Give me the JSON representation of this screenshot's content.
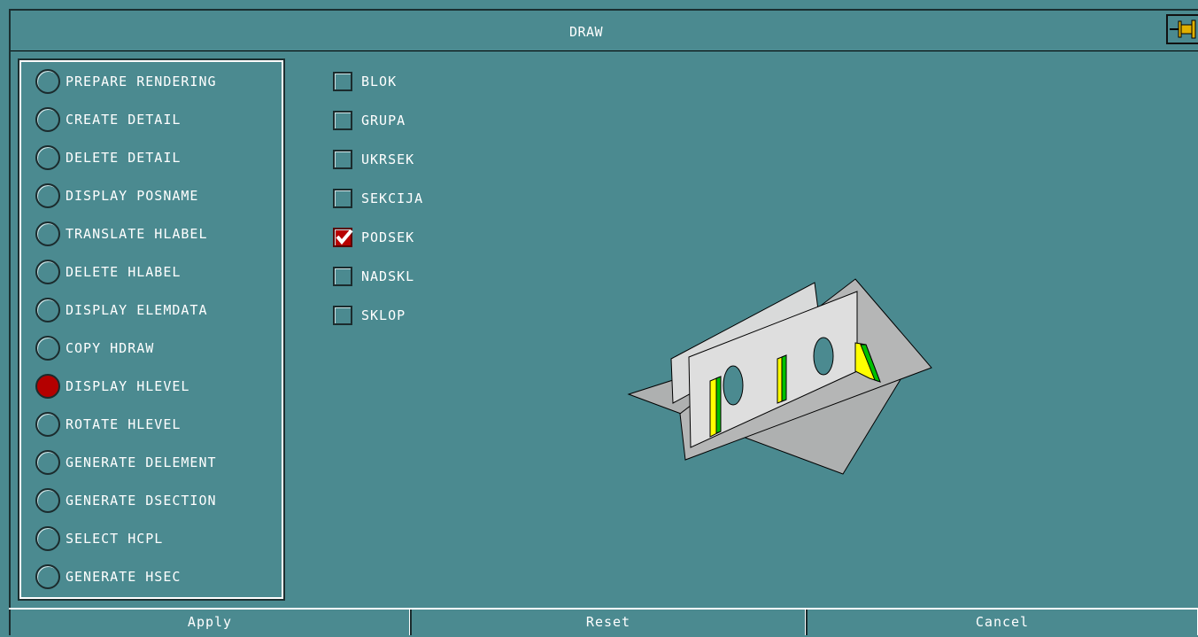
{
  "window": {
    "title": "DRAW"
  },
  "actions": [
    {
      "label": "PREPARE RENDERING",
      "checked": false
    },
    {
      "label": "CREATE DETAIL",
      "checked": false
    },
    {
      "label": "DELETE DETAIL",
      "checked": false
    },
    {
      "label": "DISPLAY POSNAME",
      "checked": false
    },
    {
      "label": "TRANSLATE HLABEL",
      "checked": false
    },
    {
      "label": "DELETE HLABEL",
      "checked": false
    },
    {
      "label": "DISPLAY ELEMDATA",
      "checked": false
    },
    {
      "label": "COPY HDRAW",
      "checked": false
    },
    {
      "label": "DISPLAY HLEVEL",
      "checked": true
    },
    {
      "label": "ROTATE HLEVEL",
      "checked": false
    },
    {
      "label": "GENERATE DELEMENT",
      "checked": false
    },
    {
      "label": "GENERATE DSECTION",
      "checked": false
    },
    {
      "label": "SELECT HCPL",
      "checked": false
    },
    {
      "label": "GENERATE HSEC",
      "checked": false
    }
  ],
  "levels": [
    {
      "label": "BLOK",
      "checked": false
    },
    {
      "label": "GRUPA",
      "checked": false
    },
    {
      "label": "UKRSEK",
      "checked": false
    },
    {
      "label": "SEKCIJA",
      "checked": false
    },
    {
      "label": "PODSEK",
      "checked": true
    },
    {
      "label": "NADSKL",
      "checked": false
    },
    {
      "label": "SKLOP",
      "checked": false
    }
  ],
  "buttons": {
    "apply": "Apply",
    "reset": "Reset",
    "cancel": "Cancel"
  },
  "colors": {
    "background": "#4b8a90",
    "selected": "#b40000",
    "highlight_yellow": "#ffff00",
    "highlight_green": "#00c000"
  }
}
